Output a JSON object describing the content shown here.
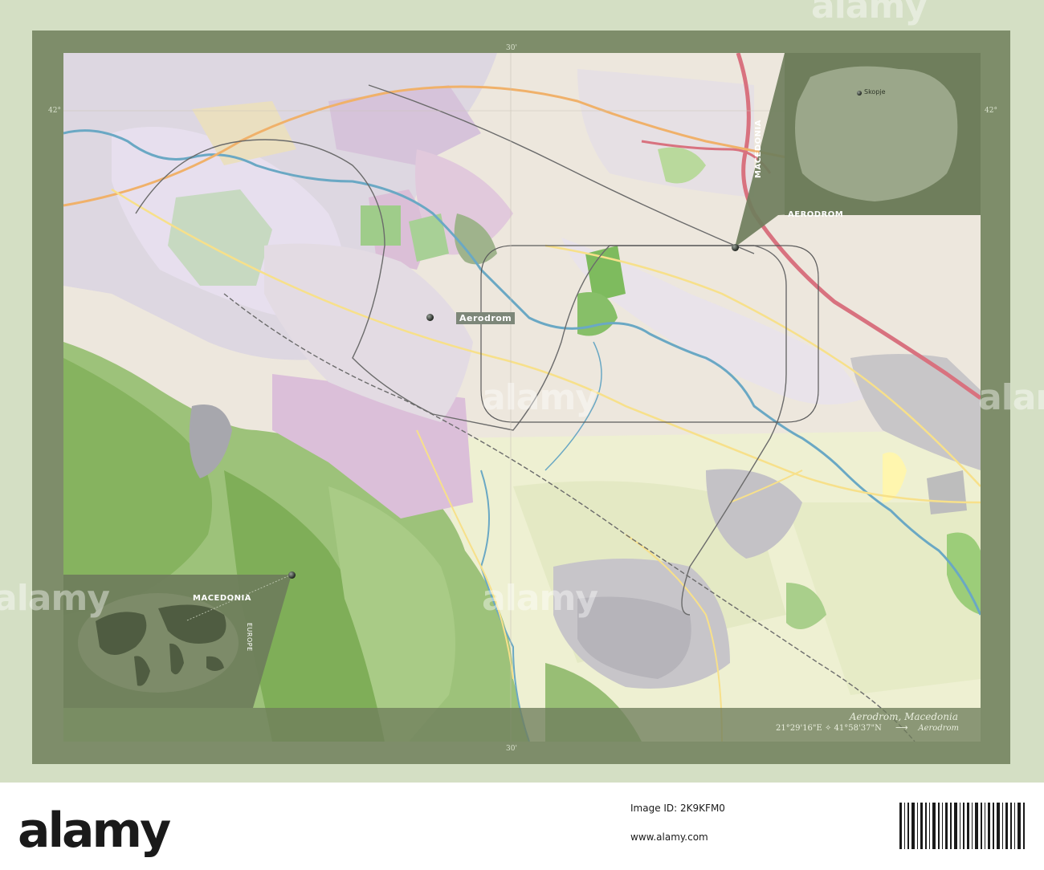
{
  "map": {
    "place_label": "Aerodrom",
    "inset_country_label": "Macedonia",
    "inset_region_label": "Aerodrom",
    "inset_city_label": "Skopje",
    "world_country_label": "Macedonia",
    "world_continent_label": "Europe",
    "footer_title": "Aerodrom, Macedonia",
    "footer_coordinates": "21°29'16\"E ✧ 41°58'37\"N",
    "footer_arrow": "⟶",
    "footer_place": "Aerodrom",
    "ticks": {
      "top_center": "30'",
      "bottom_center": "30'",
      "left_lat": "42°",
      "right_lat": "42°"
    }
  },
  "watermark": "alamy",
  "stock": {
    "logo": "alamy",
    "image_id": "Image ID: 2K9KFM0",
    "date": "www.alamy.com"
  },
  "colors": {
    "frame": "#7e8d6a",
    "map_base": "#ede7dd",
    "river": "#6aa8c4",
    "motorway": "#d8727f",
    "urban": "#c9c1c9",
    "forest": "#8fb96a",
    "inset_fill": "#6f7e5c"
  }
}
